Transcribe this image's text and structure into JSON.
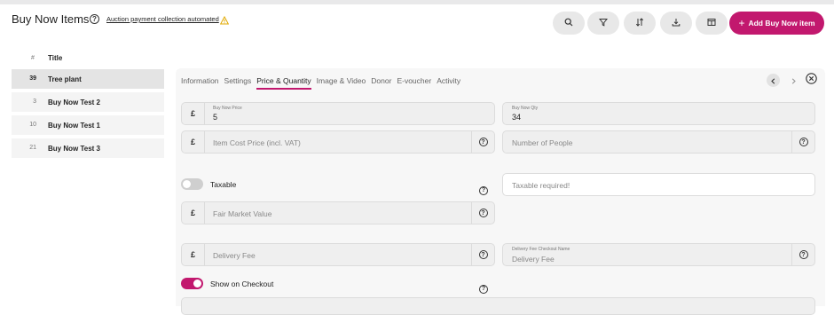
{
  "header": {
    "title": "Buy Now Items",
    "notice_link": "Auction payment collection automated",
    "add_button": "Add Buy Now item",
    "accent_color": "#c2186e"
  },
  "toolbar": {
    "icons": [
      "search-icon",
      "filter-icon",
      "sort-icon",
      "download-icon",
      "columns-icon"
    ]
  },
  "list": {
    "head_num": "#",
    "head_title": "Title",
    "items": [
      {
        "count": "39",
        "title": "Tree plant"
      },
      {
        "count": "3",
        "title": "Buy Now Test 2"
      },
      {
        "count": "10",
        "title": "Buy Now Test 1"
      },
      {
        "count": "21",
        "title": "Buy Now Test 3"
      }
    ]
  },
  "tabs": [
    "Information",
    "Settings",
    "Price & Quantity",
    "Image & Video",
    "Donor",
    "E-voucher",
    "Activity"
  ],
  "active_tab": "Price & Quantity",
  "form": {
    "currency_symbol": "£",
    "buy_now_price_label": "Buy Now Price",
    "buy_now_price_value": "5",
    "buy_now_qty_label": "Buy Now Qty",
    "buy_now_qty_value": "34",
    "item_cost_placeholder": "Item Cost Price (incl. VAT)",
    "number_of_people_placeholder": "Number of People",
    "taxable_label": "Taxable",
    "taxable_on": false,
    "taxable_required_placeholder": "Taxable required!",
    "fair_market_placeholder": "Fair Market Value",
    "delivery_fee_placeholder": "Delivery Fee",
    "delivery_checkout_label": "Delivery Fee Checkout Name",
    "delivery_checkout_placeholder": "Delivery Fee",
    "show_checkout_label": "Show on Checkout",
    "show_checkout_on": true
  }
}
